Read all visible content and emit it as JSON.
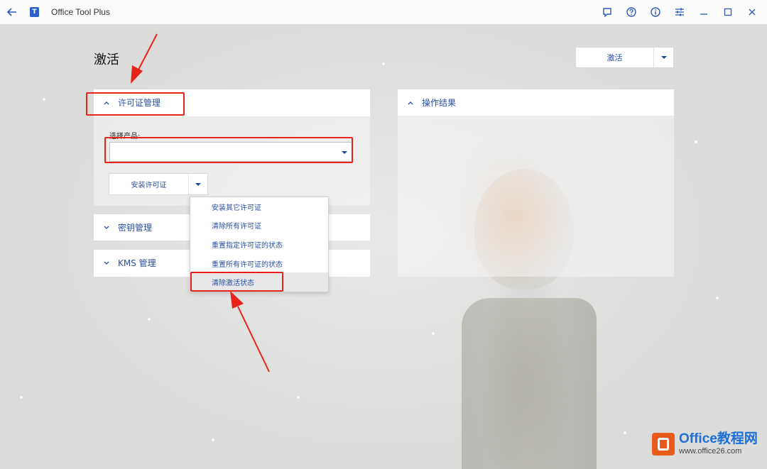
{
  "titlebar": {
    "app_title": "Office Tool Plus",
    "icons": [
      "back-arrow-icon",
      "feedback-icon",
      "help-icon",
      "info-icon",
      "settings-sliders-icon",
      "minimize-icon",
      "maximize-icon",
      "close-icon"
    ]
  },
  "page": {
    "title": "激活"
  },
  "activate_button": {
    "label": "激活"
  },
  "license_panel": {
    "header": "许可证管理",
    "product_label": "选择产品:",
    "product_value": "",
    "install_button": "安装许可证",
    "menu_items": [
      "安装其它许可证",
      "清除所有许可证",
      "重置指定许可证的状态",
      "重置所有许可证的状态",
      "清除激活状态"
    ]
  },
  "key_panel": {
    "header": "密钥管理"
  },
  "kms_panel": {
    "header": "KMS 管理"
  },
  "result_panel": {
    "header": "操作结果"
  },
  "watermark": {
    "name": "Office教程网",
    "url": "www.office26.com"
  },
  "colors": {
    "accent": "#2a4fa0",
    "annotation": "#e8231c",
    "watermark_brand": "#1f6fd6"
  }
}
